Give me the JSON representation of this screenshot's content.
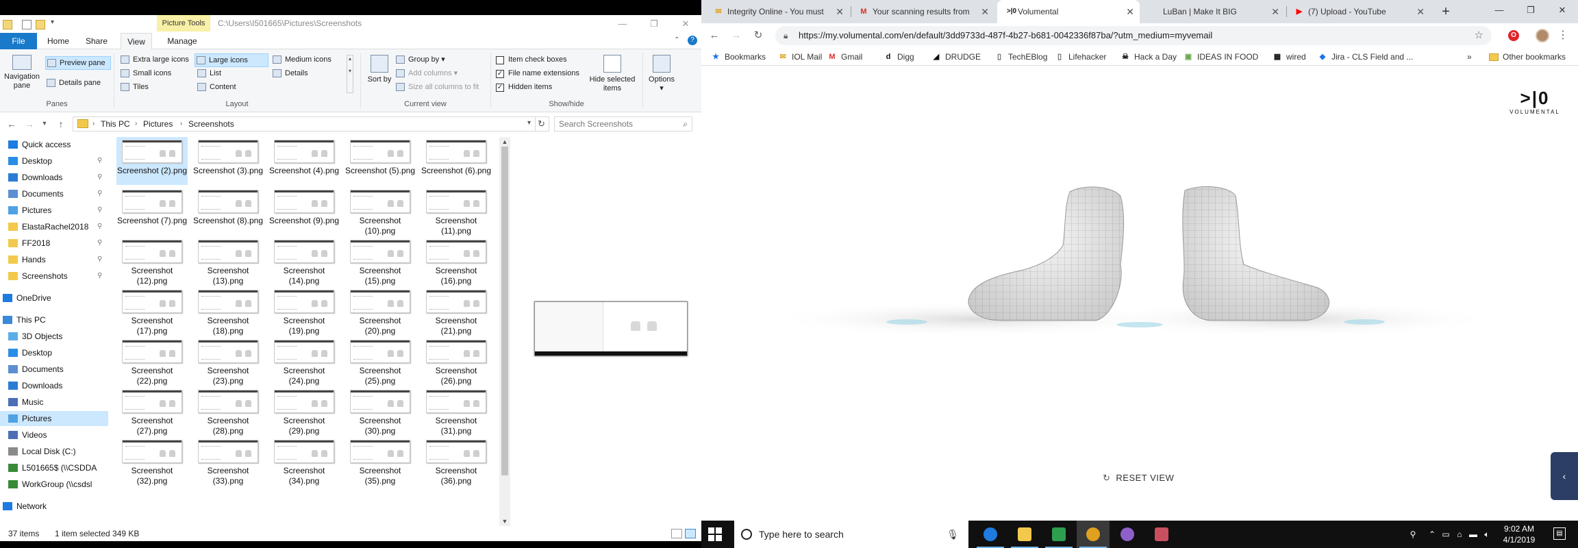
{
  "explorer": {
    "picture_tools": "Picture Tools",
    "title_path": "C:\\Users\\I501665\\Pictures\\Screenshots",
    "tabs": [
      "File",
      "Home",
      "Share",
      "View",
      "Manage"
    ],
    "ribbon": {
      "panes": {
        "navigation_pane": "Navigation pane",
        "preview_pane": "Preview pane",
        "details_pane": "Details pane",
        "label": "Panes"
      },
      "layout": {
        "items": [
          "Extra large icons",
          "Large icons",
          "Medium icons",
          "Small icons",
          "List",
          "Details",
          "Tiles",
          "Content"
        ],
        "label": "Layout"
      },
      "current_view": {
        "sort_by": "Sort by",
        "group_by": "Group by",
        "add_columns": "Add columns",
        "size_columns": "Size all columns to fit",
        "label": "Current view"
      },
      "show_hide": {
        "item_check_boxes": "Item check boxes",
        "file_name_extensions": "File name extensions",
        "hidden_items": "Hidden items",
        "hide_selected": "Hide selected items",
        "label": "Show/hide"
      },
      "options": "Options"
    },
    "breadcrumb": [
      "This PC",
      "Pictures",
      "Screenshots"
    ],
    "search_placeholder": "Search Screenshots",
    "nav": [
      {
        "label": "Quick access",
        "icon": "star-icon",
        "color": "#1e7be1"
      },
      {
        "label": "Desktop",
        "icon": "desktop-icon",
        "color": "#2a8de6",
        "pinned": true
      },
      {
        "label": "Downloads",
        "icon": "downloads-icon",
        "color": "#2a7bd6",
        "pinned": true
      },
      {
        "label": "Documents",
        "icon": "documents-icon",
        "color": "#5b8fd1",
        "pinned": true
      },
      {
        "label": "Pictures",
        "icon": "pictures-icon",
        "color": "#4ea2e4",
        "pinned": true
      },
      {
        "label": "ElastaRachel2018",
        "icon": "folder-icon",
        "color": "#f2c94c",
        "pinned": true
      },
      {
        "label": "FF2018",
        "icon": "folder-icon",
        "color": "#f2c94c",
        "pinned": true
      },
      {
        "label": "Hands",
        "icon": "folder-icon",
        "color": "#f2c94c",
        "pinned": true
      },
      {
        "label": "Screenshots",
        "icon": "folder-icon",
        "color": "#f2c94c",
        "pinned": true
      },
      {
        "label": "OneDrive",
        "icon": "cloud-icon",
        "color": "#1e7be1"
      },
      {
        "label": "This PC",
        "icon": "computer-icon",
        "color": "#3b8ad8"
      },
      {
        "label": "3D Objects",
        "icon": "cube-icon",
        "color": "#5aaee8"
      },
      {
        "label": "Desktop",
        "icon": "desktop-icon",
        "color": "#2a8de6"
      },
      {
        "label": "Documents",
        "icon": "documents-icon",
        "color": "#5b8fd1"
      },
      {
        "label": "Downloads",
        "icon": "downloads-icon",
        "color": "#2a7bd6"
      },
      {
        "label": "Music",
        "icon": "music-icon",
        "color": "#4a6fb5"
      },
      {
        "label": "Pictures",
        "icon": "pictures-icon",
        "color": "#4ea2e4",
        "selected": true
      },
      {
        "label": "Videos",
        "icon": "videos-icon",
        "color": "#4a6fb5"
      },
      {
        "label": "Local Disk (C:)",
        "icon": "drive-icon",
        "color": "#8a8a8a"
      },
      {
        "label": "L501665$ (\\\\CSDDA",
        "icon": "network-drive-icon",
        "color": "#3a8a3a"
      },
      {
        "label": "WorkGroup (\\\\csdsl",
        "icon": "network-drive-icon",
        "color": "#3a8a3a"
      },
      {
        "label": "Network",
        "icon": "network-icon",
        "color": "#1e7be1"
      }
    ],
    "files": [
      "Screenshot (2).png",
      "Screenshot (3).png",
      "Screenshot (4).png",
      "Screenshot (5).png",
      "Screenshot (6).png",
      "Screenshot (7).png",
      "Screenshot (8).png",
      "Screenshot (9).png",
      "Screenshot (10).png",
      "Screenshot (11).png",
      "Screenshot (12).png",
      "Screenshot (13).png",
      "Screenshot (14).png",
      "Screenshot (15).png",
      "Screenshot (16).png",
      "Screenshot (17).png",
      "Screenshot (18).png",
      "Screenshot (19).png",
      "Screenshot (20).png",
      "Screenshot (21).png",
      "Screenshot (22).png",
      "Screenshot (23).png",
      "Screenshot (24).png",
      "Screenshot (25).png",
      "Screenshot (26).png",
      "Screenshot (27).png",
      "Screenshot (28).png",
      "Screenshot (29).png",
      "Screenshot (30).png",
      "Screenshot (31).png",
      "Screenshot (32).png",
      "Screenshot (33).png",
      "Screenshot (34).png",
      "Screenshot (35).png",
      "Screenshot (36).png"
    ],
    "selected_index": 0,
    "status": {
      "count": "37 items",
      "selection": "1 item selected  349 KB"
    }
  },
  "chrome": {
    "tabs": [
      {
        "title": "Integrity Online - You must",
        "icon": "mail-icon",
        "icon_text": "✉",
        "color": "#e0a020"
      },
      {
        "title": "Your scanning results from",
        "icon": "gmail-icon",
        "icon_text": "M",
        "color": "#d93025"
      },
      {
        "title": "Volumental",
        "icon": "volumental-icon",
        "icon_text": ">|0",
        "color": "#111111",
        "active": true
      },
      {
        "title": "LuBan | Make It BIG",
        "icon": "luban-icon",
        "icon_text": "",
        "color": "#888888"
      },
      {
        "title": "(7) Upload - YouTube",
        "icon": "youtube-icon",
        "icon_text": "▶",
        "color": "#ff0000"
      }
    ],
    "url": "https://my.volumental.com/en/default/3dd9733d-487f-4b27-b681-0042336f87ba/?utm_medium=myvemail",
    "bookmarks": [
      {
        "label": "Bookmarks",
        "icon": "star-icon",
        "icon_text": "★",
        "color": "#1a73e8"
      },
      {
        "label": "IOL Mail",
        "icon": "mail-icon",
        "icon_text": "✉",
        "color": "#e0a020"
      },
      {
        "label": "Gmail",
        "icon": "gmail-icon",
        "icon_text": "M",
        "color": "#d93025"
      },
      {
        "label": "Digg",
        "icon": "digg-icon",
        "icon_text": "d",
        "color": "#111111"
      },
      {
        "label": "DRUDGE",
        "icon": "drudge-icon",
        "icon_text": "◢",
        "color": "#111111"
      },
      {
        "label": "TechEBlog",
        "icon": "page-icon",
        "icon_text": "▯",
        "color": "#5f6368"
      },
      {
        "label": "Lifehacker",
        "icon": "page-icon",
        "icon_text": "▯",
        "color": "#5f6368"
      },
      {
        "label": "Hack a Day",
        "icon": "hackaday-icon",
        "icon_text": "☠",
        "color": "#111111"
      },
      {
        "label": "IDEAS IN FOOD",
        "icon": "ideas-icon",
        "icon_text": "▣",
        "color": "#6aa84f"
      },
      {
        "label": "wired",
        "icon": "wired-icon",
        "icon_text": "▦",
        "color": "#111111"
      },
      {
        "label": "Jira - CLS Field and ...",
        "icon": "jira-icon",
        "icon_text": "◆",
        "color": "#1a73e8"
      }
    ],
    "other_bookmarks": "Other bookmarks",
    "overflow": "»",
    "logo_mark": ">|0",
    "logo_word": "VOLUMENTAL",
    "reset_view": "RESET VIEW",
    "side_tab": "‹"
  },
  "taskbar": {
    "search_placeholder": "Type here to search",
    "apps": [
      {
        "icon": "edge-icon",
        "color": "#1e7be1"
      },
      {
        "icon": "file-explorer-icon",
        "color": "#f2c94c"
      },
      {
        "icon": "sheets-icon",
        "color": "#2e9e4f"
      },
      {
        "icon": "chrome-icon",
        "color": "#e0a020",
        "active": true
      },
      {
        "icon": "app-purple-icon",
        "color": "#8f5fc9"
      },
      {
        "icon": "app-cat-icon",
        "color": "#c94f5f"
      }
    ],
    "time": "9:02 AM",
    "date": "4/1/2019"
  }
}
